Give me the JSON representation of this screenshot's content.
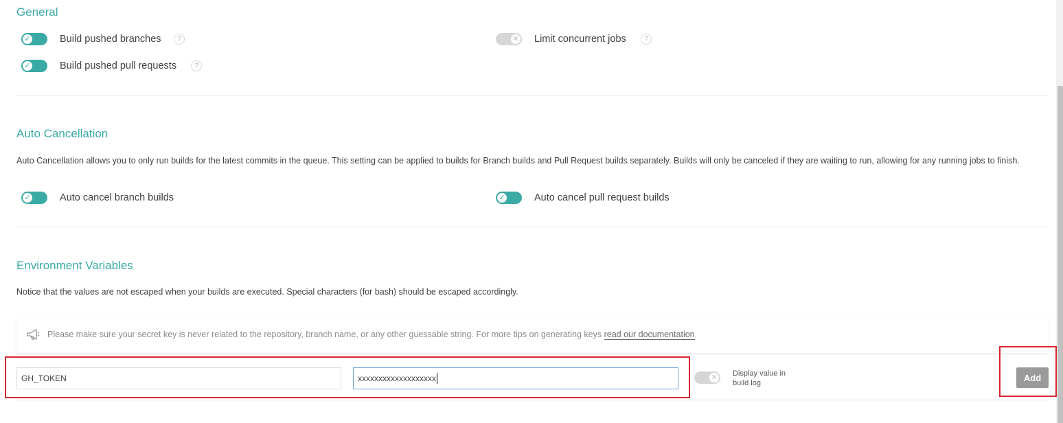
{
  "general": {
    "title": "General",
    "build_pushed_branches": {
      "label": "Build pushed branches",
      "enabled": true
    },
    "build_pushed_pull_requests": {
      "label": "Build pushed pull requests",
      "enabled": true
    },
    "limit_concurrent_jobs": {
      "label": "Limit concurrent jobs",
      "enabled": false
    },
    "help_glyph": "?"
  },
  "auto_cancellation": {
    "title": "Auto Cancellation",
    "description": "Auto Cancellation allows you to only run builds for the latest commits in the queue. This setting can be applied to builds for Branch builds and Pull Request builds separately. Builds will only be canceled if they are waiting to run, allowing for any running jobs to finish.",
    "branch_builds": {
      "label": "Auto cancel branch builds",
      "enabled": true
    },
    "pull_request_builds": {
      "label": "Auto cancel pull request builds",
      "enabled": true
    }
  },
  "environment_variables": {
    "title": "Environment Variables",
    "description": "Notice that the values are not escaped when your builds are executed. Special characters (for bash) should be escaped accordingly.",
    "notice": {
      "icon": "megaphone-icon",
      "text": "Please make sure your secret key is never related to the repository, branch name, or any other guessable string. For more tips on generating keys ",
      "link_text": "read our documentation",
      "suffix": "."
    },
    "name_value": "GH_TOKEN",
    "value_value": "xxxxxxxxxxxxxxxxxxx",
    "display_in_log": {
      "label_line1": "Display value in",
      "label_line2": "build log",
      "enabled": false
    },
    "add_button": "Add"
  },
  "colors": {
    "accent": "#39aaa4",
    "highlight": "#d9272e",
    "button_disabled": "#9a9a9a"
  },
  "toggle_glyphs": {
    "on": "✓",
    "off": "✕"
  }
}
